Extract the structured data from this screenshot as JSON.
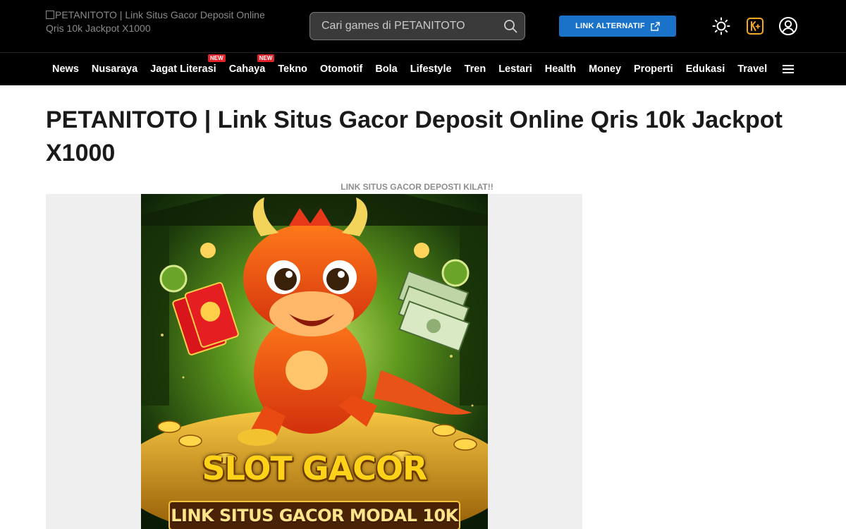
{
  "header": {
    "logo_alt": "PETANITOTO | Link Situs Gacor Deposit Online Qris 10k Jackpot X1000",
    "search_placeholder": "Cari games di PETANITOTO",
    "alt_link_label": "LINK ALTERNATIF",
    "icons": [
      "sun-icon",
      "kplus-icon",
      "user-icon",
      "search-icon",
      "external-link-icon"
    ]
  },
  "nav": {
    "items": [
      {
        "label": "News"
      },
      {
        "label": "Nusaraya"
      },
      {
        "label": "Jagat Literasi",
        "badge": "NEW"
      },
      {
        "label": "Cahaya",
        "badge": "NEW"
      },
      {
        "label": "Tekno"
      },
      {
        "label": "Otomotif"
      },
      {
        "label": "Bola"
      },
      {
        "label": "Lifestyle"
      },
      {
        "label": "Tren"
      },
      {
        "label": "Lestari"
      },
      {
        "label": "Health"
      },
      {
        "label": "Money"
      },
      {
        "label": "Properti"
      },
      {
        "label": "Edukasi"
      },
      {
        "label": "Travel"
      }
    ],
    "menu_icon": "hamburger-icon"
  },
  "article": {
    "title": "PETANITOTO | Link Situs Gacor Deposit Online Qris 10k Jackpot X1000",
    "banner_caption": "LINK SITUS GACOR DEPOSTI KILAT!!",
    "banner": {
      "headline": "SLOT GACOR",
      "subline": "LINK SITUS GACOR MODAL 10K"
    }
  },
  "colors": {
    "header_bg": "#000000",
    "accent_button": "#1a73c9",
    "badge_red": "#e0222a",
    "kplus_gold": "#f5a623"
  }
}
